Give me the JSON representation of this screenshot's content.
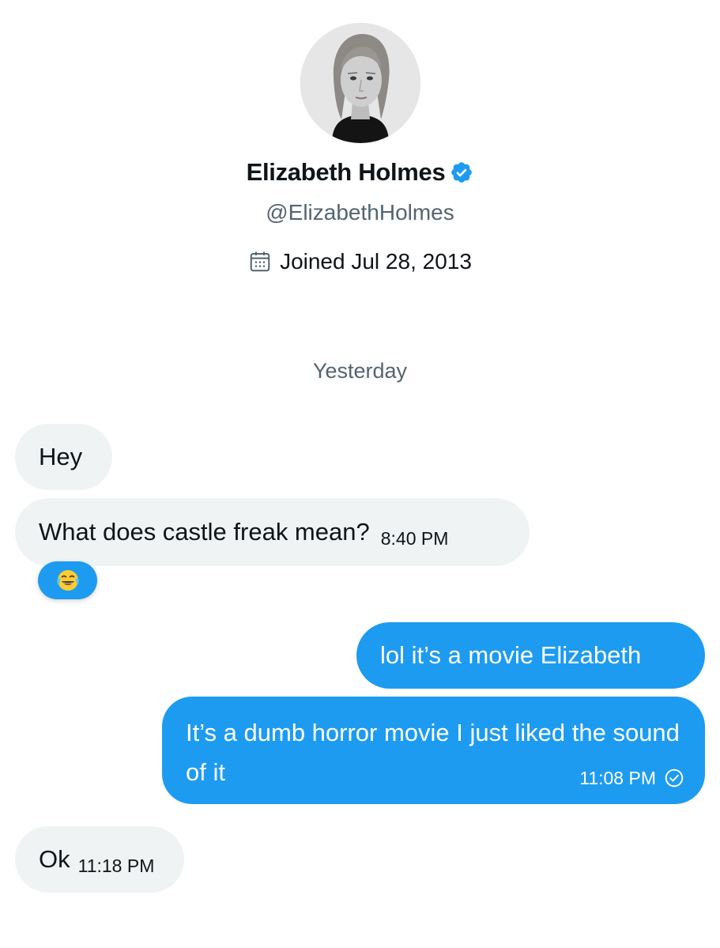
{
  "profile": {
    "name": "Elizabeth Holmes",
    "handle": "@ElizabethHolmes",
    "joined": "Joined Jul 28, 2013",
    "avatar_icon": "profile-photo",
    "verified_icon": "verified-badge-icon",
    "calendar_icon": "calendar-icon"
  },
  "conversation": {
    "day_separator": "Yesterday",
    "messages": [
      {
        "direction": "received",
        "text": "Hey",
        "time": ""
      },
      {
        "direction": "received",
        "text": "What does castle freak mean?",
        "time": "8:40 PM",
        "reaction": "face-with-tears-of-joy"
      },
      {
        "direction": "sent",
        "text": "lol it’s a movie Elizabeth",
        "time": ""
      },
      {
        "direction": "sent",
        "text": "It’s a dumb horror movie I just liked the sound of it",
        "time": "11:08 PM",
        "status": "seen"
      },
      {
        "direction": "received",
        "text": "Ok",
        "time": "11:18 PM"
      }
    ]
  },
  "colors": {
    "accent": "#1d9bf0",
    "received_bubble": "#eff3f4",
    "secondary_text": "#536471",
    "primary_text": "#0f1419"
  }
}
